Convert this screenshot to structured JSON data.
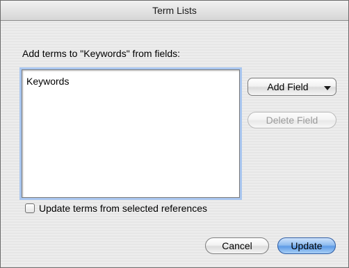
{
  "window": {
    "title": "Term Lists"
  },
  "dialog": {
    "prompt": "Add terms to \"Keywords\" from fields:",
    "fields_list": {
      "items": [
        "Keywords"
      ]
    },
    "buttons": {
      "add_field": "Add Field",
      "delete_field": "Delete Field",
      "cancel": "Cancel",
      "update": "Update"
    },
    "update_from_selected": {
      "label": "Update terms from selected references",
      "checked": false
    }
  },
  "colors": {
    "default_button": "#5e9be6",
    "focus_ring": "#a9c6ef",
    "disabled_text": "#9a9a9a"
  }
}
